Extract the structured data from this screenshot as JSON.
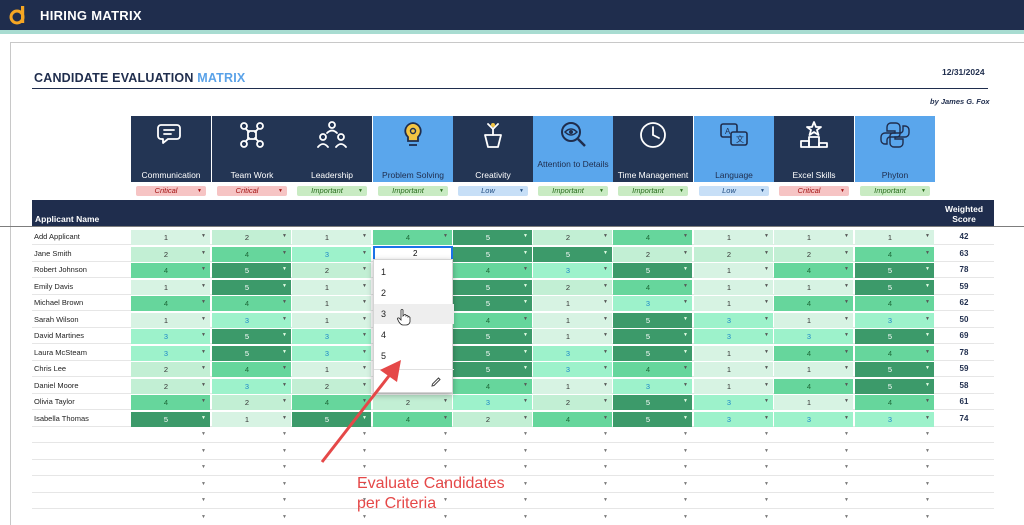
{
  "app": {
    "title": "HIRING MATRIX"
  },
  "document": {
    "title_part1": "CANDIDATE EVALUATION ",
    "title_part2": "MATRIX",
    "date": "12/31/2024",
    "author": "by James G. Fox"
  },
  "criteria": [
    {
      "name": "Communication",
      "importance": "Critical",
      "icon": "chat-bubbles-icon"
    },
    {
      "name": "Team Work",
      "importance": "Critical",
      "icon": "team-puzzle-icon"
    },
    {
      "name": "Leadership",
      "importance": "Important",
      "icon": "leadership-people-icon"
    },
    {
      "name": "Problem Solving",
      "importance": "Important",
      "icon": "lightbulb-gear-icon"
    },
    {
      "name": "Creativity",
      "importance": "Low",
      "icon": "creative-pot-icon"
    },
    {
      "name": "Attention to Details",
      "importance": "Important",
      "icon": "magnifier-eye-icon"
    },
    {
      "name": "Time Management",
      "importance": "Important",
      "icon": "clock-icon"
    },
    {
      "name": "Language",
      "importance": "Low",
      "icon": "translate-icon"
    },
    {
      "name": "Excel Skills",
      "importance": "Critical",
      "icon": "podium-star-icon"
    },
    {
      "name": "Phyton",
      "importance": "Important",
      "icon": "python-icon"
    }
  ],
  "table": {
    "name_header": "Applicant Name",
    "score_header": "Weighted Score",
    "rows": [
      {
        "name": "Add Applicant",
        "scores": [
          "1",
          "2",
          "1",
          "4",
          "5",
          "2",
          "4",
          "1",
          "1",
          "1"
        ],
        "weighted": "42"
      },
      {
        "name": "Jane Smith",
        "scores": [
          "2",
          "4",
          "3",
          "2",
          "5",
          "5",
          "2",
          "2",
          "2",
          "4"
        ],
        "weighted": "63"
      },
      {
        "name": "Robert Johnson",
        "scores": [
          "4",
          "5",
          "2",
          "",
          "4",
          "3",
          "5",
          "1",
          "4",
          "5"
        ],
        "weighted": "78"
      },
      {
        "name": "Emily Davis",
        "scores": [
          "1",
          "5",
          "1",
          "",
          "5",
          "2",
          "4",
          "1",
          "1",
          "5"
        ],
        "weighted": "59"
      },
      {
        "name": "Michael Brown",
        "scores": [
          "4",
          "4",
          "1",
          "",
          "5",
          "1",
          "3",
          "1",
          "4",
          "4"
        ],
        "weighted": "62"
      },
      {
        "name": "Sarah Wilson",
        "scores": [
          "1",
          "3",
          "1",
          "",
          "4",
          "1",
          "5",
          "3",
          "1",
          "3"
        ],
        "weighted": "50"
      },
      {
        "name": "David Martines",
        "scores": [
          "3",
          "5",
          "3",
          "",
          "5",
          "1",
          "5",
          "3",
          "3",
          "5"
        ],
        "weighted": "69"
      },
      {
        "name": "Laura McSteam",
        "scores": [
          "3",
          "5",
          "3",
          "",
          "5",
          "3",
          "5",
          "1",
          "4",
          "4"
        ],
        "weighted": "78"
      },
      {
        "name": "Chris Lee",
        "scores": [
          "2",
          "4",
          "1",
          "",
          "5",
          "3",
          "4",
          "1",
          "1",
          "5"
        ],
        "weighted": "59"
      },
      {
        "name": "Daniel Moore",
        "scores": [
          "2",
          "3",
          "2",
          "",
          "4",
          "1",
          "3",
          "1",
          "4",
          "5"
        ],
        "weighted": "58"
      },
      {
        "name": "Olivia Taylor",
        "scores": [
          "4",
          "2",
          "4",
          "2",
          "3",
          "2",
          "5",
          "3",
          "1",
          "4"
        ],
        "weighted": "61"
      },
      {
        "name": "Isabella Thomas",
        "scores": [
          "5",
          "1",
          "5",
          "4",
          "2",
          "4",
          "5",
          "3",
          "3",
          "3"
        ],
        "weighted": "74"
      },
      {
        "name": "",
        "scores": [
          "",
          "",
          "",
          "",
          "",
          "",
          "",
          "",
          "",
          ""
        ],
        "weighted": ""
      },
      {
        "name": "",
        "scores": [
          "",
          "",
          "",
          "",
          "",
          "",
          "",
          "",
          "",
          ""
        ],
        "weighted": ""
      },
      {
        "name": "",
        "scores": [
          "",
          "",
          "",
          "",
          "",
          "",
          "",
          "",
          "",
          ""
        ],
        "weighted": ""
      },
      {
        "name": "",
        "scores": [
          "",
          "",
          "",
          "",
          "",
          "",
          "",
          "",
          "",
          ""
        ],
        "weighted": ""
      },
      {
        "name": "",
        "scores": [
          "",
          "",
          "",
          "",
          "",
          "",
          "",
          "",
          "",
          ""
        ],
        "weighted": ""
      },
      {
        "name": "",
        "scores": [
          "",
          "",
          "",
          "",
          "",
          "",
          "",
          "",
          "",
          ""
        ],
        "weighted": ""
      }
    ]
  },
  "active_cell": {
    "value": "2"
  },
  "dropdown": {
    "options": [
      "1",
      "2",
      "3",
      "4",
      "5"
    ],
    "hovered": "3"
  },
  "annotation": {
    "line1": "Evaluate Candidates",
    "line2": "per Criteria",
    "color": "#e54848"
  },
  "colors": {
    "navy": "#1f2d4d",
    "accent_blue": "#5aa6ec",
    "teal": "#a8dcd1"
  }
}
